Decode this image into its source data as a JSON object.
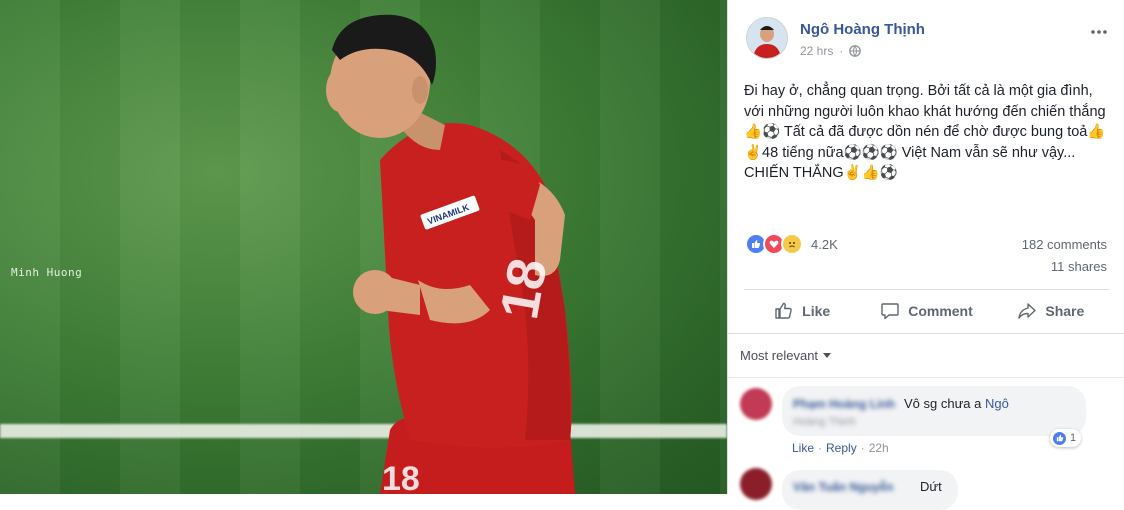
{
  "photo": {
    "watermark": "Minh Huong",
    "jersey": {
      "brand": "VINAMILK",
      "number": "18"
    }
  },
  "post": {
    "author": "Ngô Hoàng Thịnh",
    "time": "22 hrs",
    "privacy_icon": "globe-icon",
    "more_icon": "more-options-icon",
    "text": "Đi hay ở, chẳng quan trọng. Bởi tất cả là một gia đình, với những người luôn khao khát hướng đến chiến thắng👍⚽ Tất cả đã được dồn nén để chờ được bung toả👍✌48 tiếng nữa⚽⚽⚽ Việt Nam vẫn sẽ như vậy... CHIẾN THẮNG✌👍⚽",
    "reactions_count": "4.2K",
    "comments_count": "182 comments",
    "shares_count": "11 shares"
  },
  "actions": {
    "like": "Like",
    "comment": "Comment",
    "share": "Share"
  },
  "comments": {
    "sort_label": "Most relevant",
    "items": [
      {
        "author": "Phạm Hoàng Linh",
        "subtitle": "Hoàng Thịnh",
        "text": "Vô sg chưa a ",
        "mention": "Ngô",
        "like_label": "Like",
        "reply_label": "Reply",
        "time": "22h",
        "reaction_count": "1"
      },
      {
        "author": "Văn Tuấn Nguyễn",
        "text": "Dứt"
      }
    ]
  },
  "colors": {
    "brand_link": "#385898",
    "jersey_red": "#c8201f",
    "grass": "#3f7f37"
  }
}
